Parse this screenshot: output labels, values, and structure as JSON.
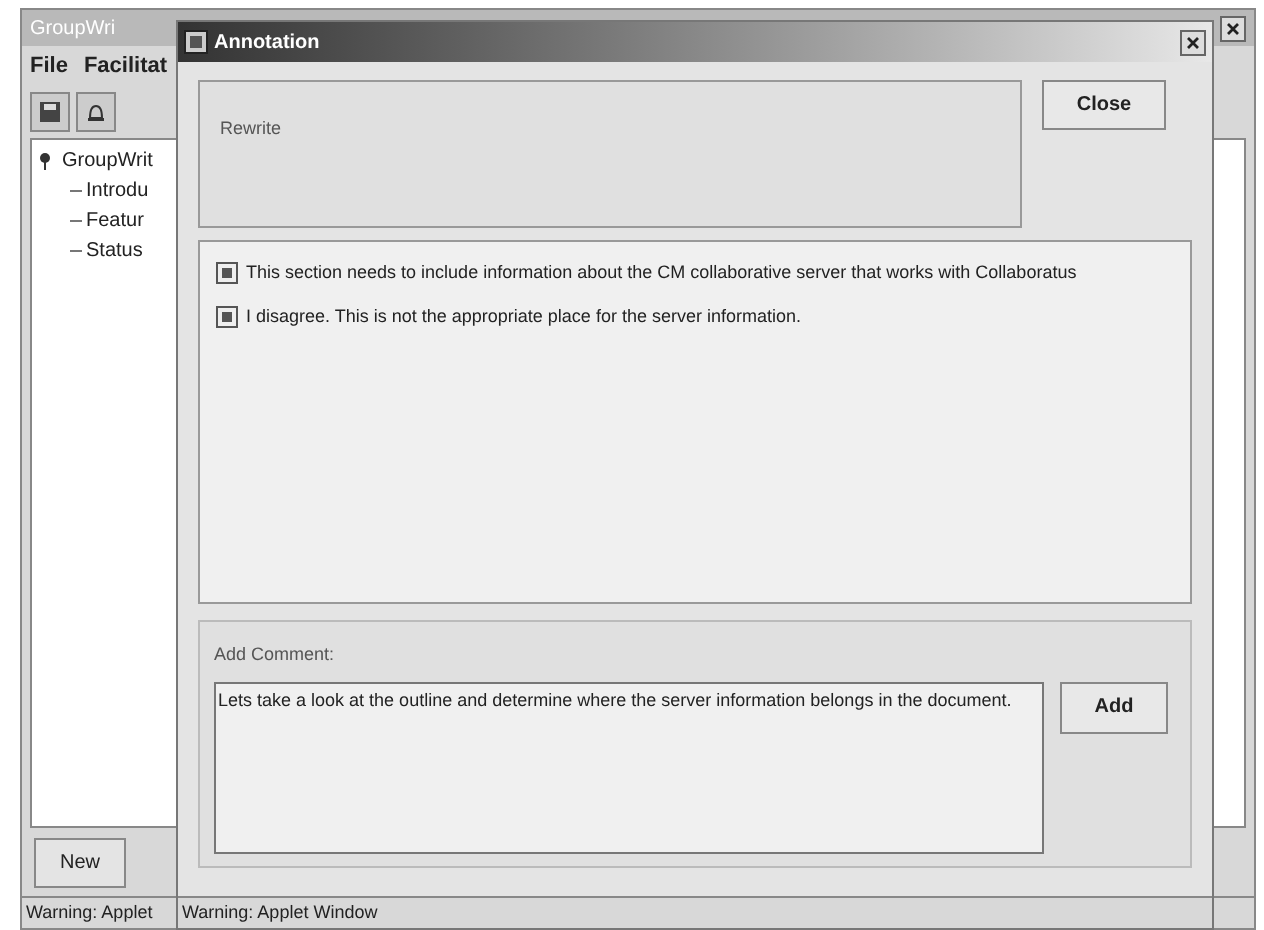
{
  "main_window": {
    "title": "GroupWri",
    "menu": [
      "File",
      "Facilitat"
    ],
    "tree": {
      "label": "GroupWrit",
      "expanded": true,
      "children": [
        {
          "label": "Introdu"
        },
        {
          "label": "Featur"
        },
        {
          "label": "Status"
        }
      ]
    },
    "buttons": [
      "New"
    ],
    "status": "Warning: Applet"
  },
  "dialog": {
    "title": "Annotation",
    "heading_label": "Rewrite",
    "close_button": "Close",
    "comments": [
      {
        "text": "This section needs to include information about the CM collaborative server that works with Collaboratus"
      },
      {
        "text": "I disagree. This is not the appropriate place for the server information."
      }
    ],
    "add_comment": {
      "label": "Add Comment:",
      "value": "Lets take a look at the outline and determine where the server information belongs in the document.",
      "button": "Add"
    },
    "status": "Warning: Applet Window"
  }
}
